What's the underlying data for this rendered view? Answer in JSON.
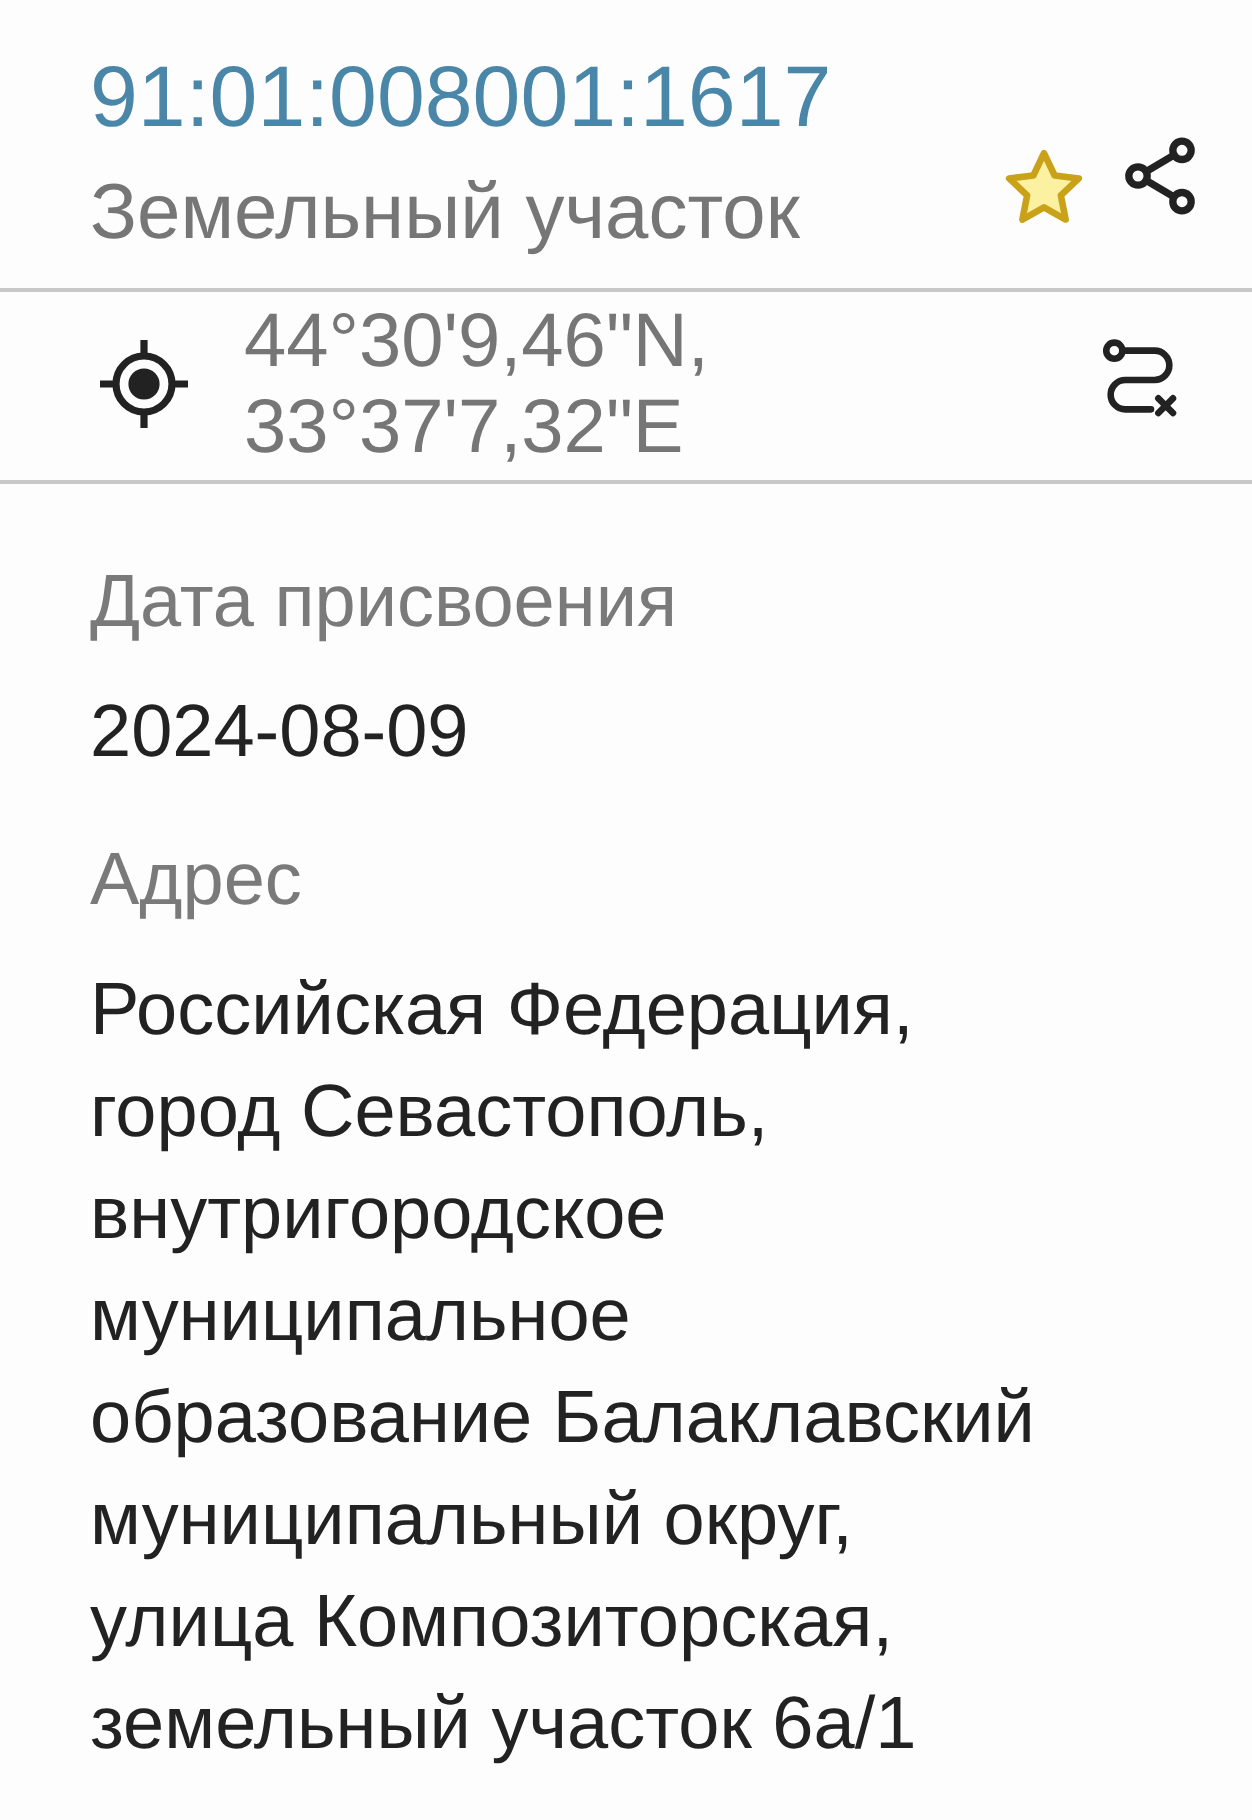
{
  "header": {
    "title": "91:01:008001:1617",
    "subtitle": "Земельный участок",
    "favorite": true
  },
  "coordinates": {
    "lines": [
      "44°30'9,46\"N,",
      "33°37'7,32\"E"
    ]
  },
  "fields": [
    {
      "label": "Дата присвоения",
      "value_lines": [
        "2024-08-09"
      ]
    },
    {
      "label": "Адрес",
      "value_lines": [
        "Российская Федерация,",
        "город Севастополь,",
        "внутригородское",
        "муниципальное",
        "образование Балаклавский",
        "муниципальный округ,",
        "улица Композиторская,",
        "земельный участок 6а/1"
      ]
    }
  ]
}
